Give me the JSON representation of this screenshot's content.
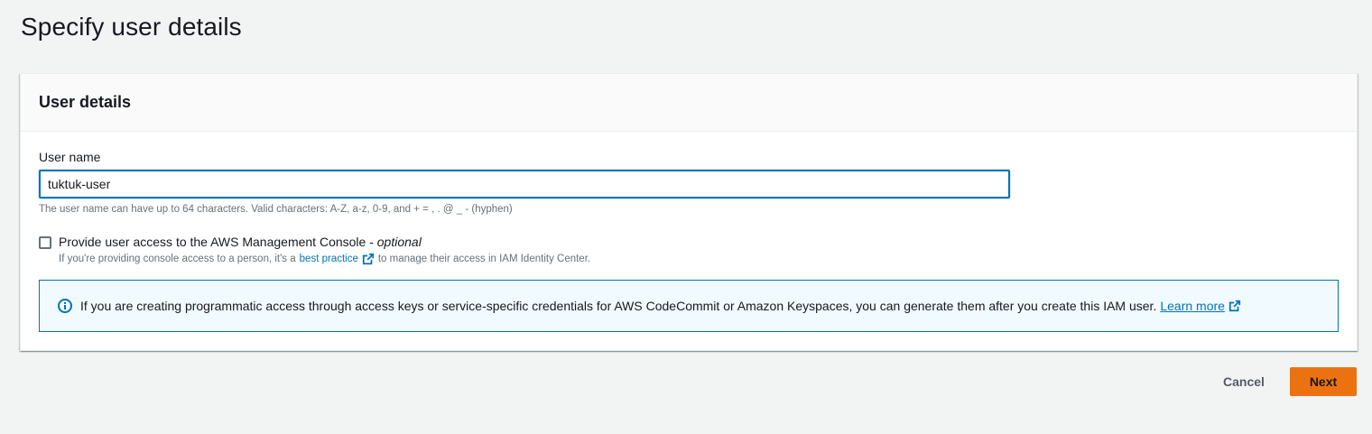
{
  "page": {
    "title": "Specify user details"
  },
  "user_details": {
    "heading": "User details",
    "username_label": "User name",
    "username_value": "tuktuk-user",
    "username_hint": "The user name can have up to 64 characters. Valid characters: A-Z, a-z, 0-9, and + = , . @ _ - (hyphen)",
    "console_access": {
      "checked": false,
      "label": "Provide user access to the AWS Management Console - ",
      "label_optional": "optional",
      "desc_before": "If you're providing console access to a person, it's a",
      "desc_link": "best practice",
      "desc_after": "to manage their access in IAM Identity Center."
    },
    "info_alert": {
      "text": "If you are creating programmatic access through access keys or service-specific credentials for AWS CodeCommit or Amazon Keyspaces, you can generate them after you create this IAM user.",
      "link": "Learn more"
    }
  },
  "actions": {
    "cancel_label": "Cancel",
    "next_label": "Next"
  },
  "colors": {
    "primary_button": "#ec7211",
    "link": "#0073bb",
    "info_background": "#f1faff",
    "page_background": "#f2f3f3"
  },
  "icons": {
    "external_link": "external-link-icon",
    "info": "info-icon"
  }
}
